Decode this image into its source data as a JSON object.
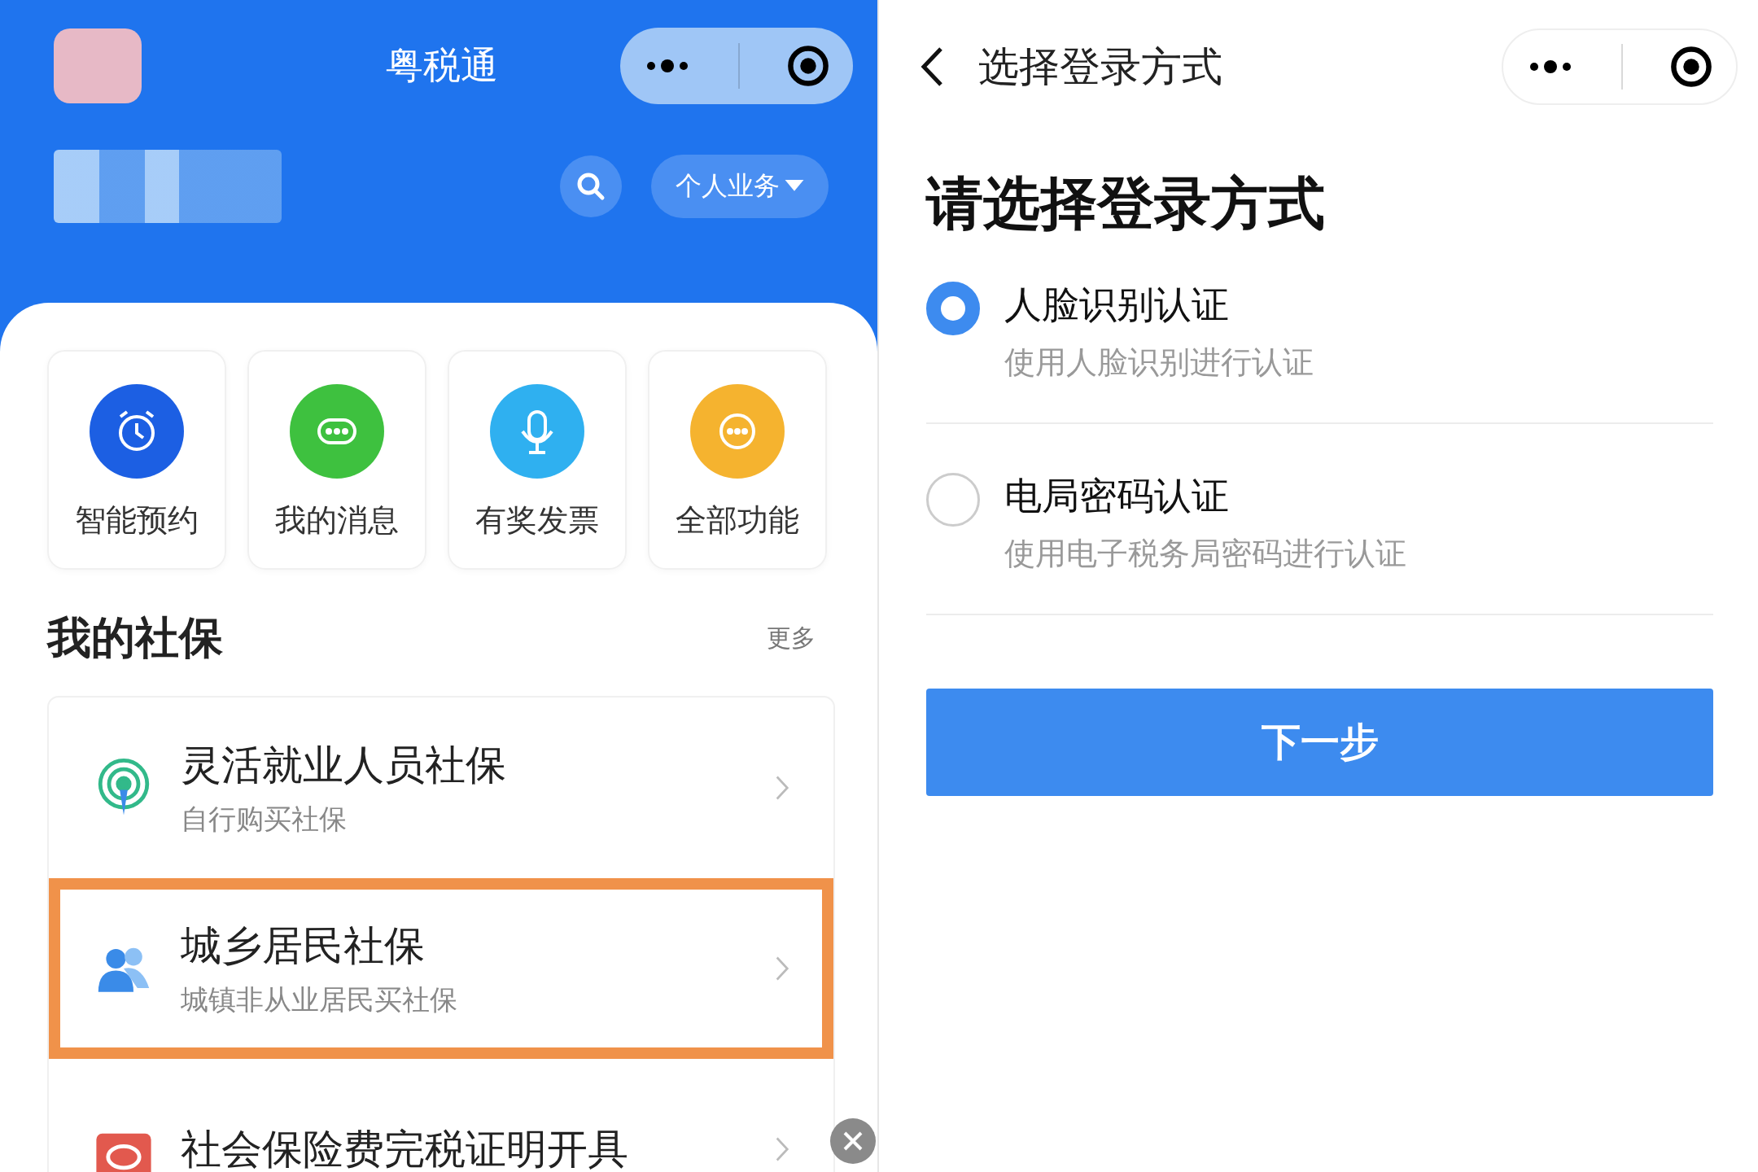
{
  "left": {
    "header": {
      "title": "粤税通",
      "business_button": "个人业务"
    },
    "shortcuts": [
      {
        "label": "智能预约",
        "kind": "alarm",
        "color": "#1c5fe3"
      },
      {
        "label": "我的消息",
        "kind": "chat",
        "color": "#3ec13f"
      },
      {
        "label": "有奖发票",
        "kind": "mic",
        "color": "#2fb0f0"
      },
      {
        "label": "全部功能",
        "kind": "dots",
        "color": "#f5b32f"
      }
    ],
    "section": {
      "title": "我的社保",
      "more": "更多"
    },
    "items": [
      {
        "title": "灵活就业人员社保",
        "subtitle": "自行购买社保",
        "kind": "signal",
        "highlighted": false
      },
      {
        "title": "城乡居民社保",
        "subtitle": "城镇非从业居民买社保",
        "kind": "people",
        "highlighted": true
      },
      {
        "title": "社会保险费完税证明开具",
        "kind": "badge",
        "highlighted": false
      }
    ]
  },
  "right": {
    "nav_title": "选择登录方式",
    "heading": "请选择登录方式",
    "options": [
      {
        "title": "人脸识别认证",
        "subtitle": "使用人脸识别进行认证",
        "selected": true
      },
      {
        "title": "电局密码认证",
        "subtitle": "使用电子税务局密码进行认证",
        "selected": false
      }
    ],
    "next_button": "下一步"
  }
}
